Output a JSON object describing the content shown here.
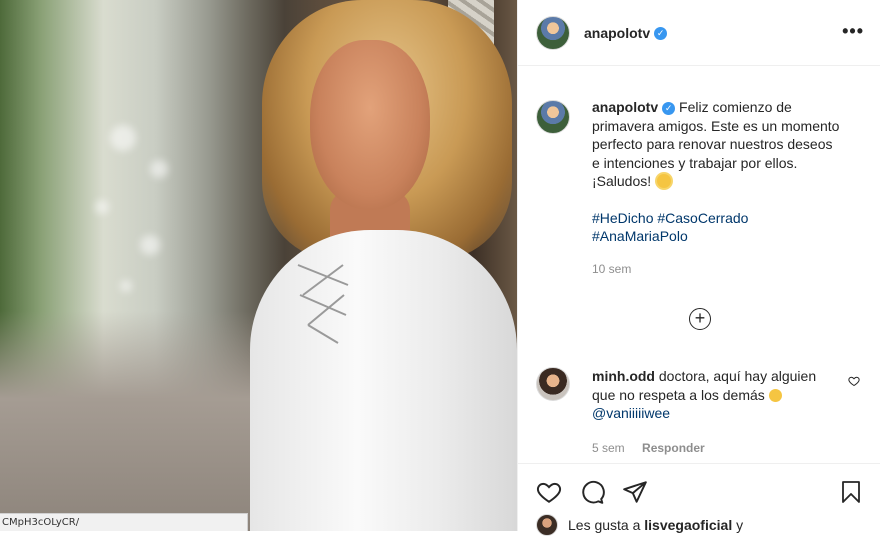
{
  "post": {
    "username": "anapolotv",
    "verified_mark": "✓",
    "more_label": "•••"
  },
  "caption": {
    "username": "anapolotv",
    "text": "Feliz comienzo de primavera amigos. Este es un momento perfecto para renovar nuestros deseos e intenciones y trabajar por ellos. ¡Saludos!",
    "emoji": "sun-emoji",
    "tags": [
      "#HeDicho",
      "#CasoCerrado",
      "#AnaMariaPolo"
    ],
    "time": "10 sem"
  },
  "comment": {
    "username": "minh.odd",
    "text": "doctora, aquí hay alguien que no respeta a los demás",
    "emoji": "sad-face-emoji",
    "mention": "@vaniiiiiwee",
    "time": "5 sem",
    "reply_label": "Responder"
  },
  "likes": {
    "prefix": "Les gusta a",
    "user": "lisvegaoficial",
    "suffix": "y"
  },
  "status_bar": {
    "url": "CMpH3cOLyCR/"
  },
  "icons": {
    "add_comment": "plus-circle-icon",
    "like": "heart-icon",
    "comment": "comment-icon",
    "share": "paper-plane-icon",
    "save": "bookmark-icon",
    "comment_like": "small-heart-icon"
  },
  "colors": {
    "verified": "#3897f0",
    "link": "#00376b",
    "muted": "#8e8e8e",
    "text": "#262626"
  }
}
